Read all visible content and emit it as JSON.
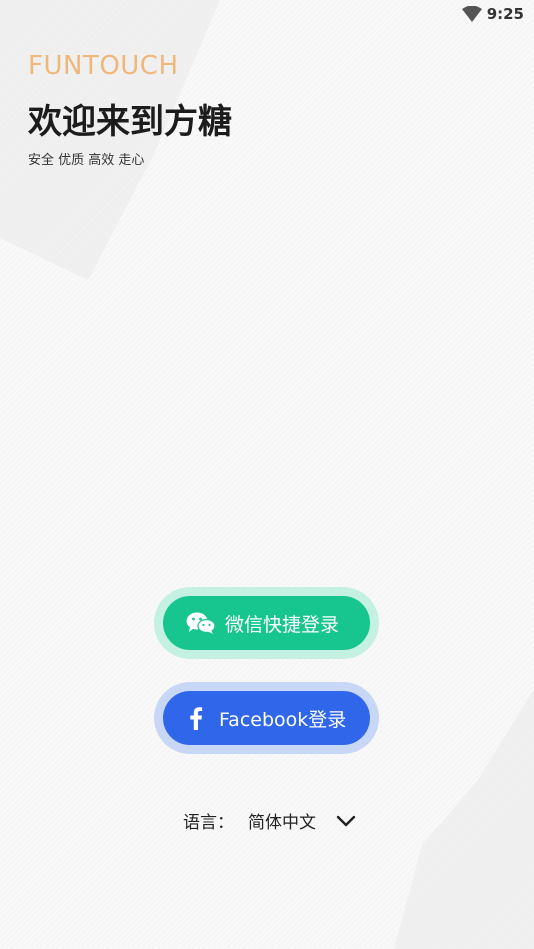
{
  "status_bar": {
    "time": "9:25",
    "wifi_icon": "wifi-icon"
  },
  "header": {
    "brand": "FUNTOUCH",
    "title": "欢迎来到方糖",
    "subtitle": "安全 优质 高效 走心"
  },
  "login": {
    "wechat_label": "微信快捷登录",
    "wechat_icon": "wechat-icon",
    "facebook_label": "Facebook登录",
    "facebook_icon": "facebook-icon"
  },
  "language": {
    "label": "语言：",
    "value": "简体中文",
    "dropdown_icon": "chevron-down-icon"
  },
  "colors": {
    "brand": "#f0b77a",
    "wechat": "#17c58f",
    "facebook": "#2f66ea"
  }
}
